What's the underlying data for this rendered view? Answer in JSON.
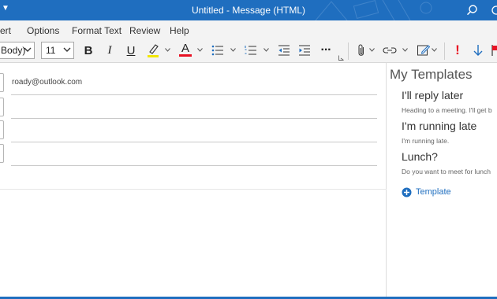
{
  "window": {
    "title": "Untitled  -  Message (HTML)",
    "accent": "#1f6ebf"
  },
  "menu": {
    "tabs": [
      "ert",
      "Options",
      "Format Text",
      "Review",
      "Help"
    ]
  },
  "ribbon": {
    "font_name": "Body)",
    "font_size": "11",
    "buttons": [
      "bold",
      "italic",
      "underline",
      "highlight",
      "font-color",
      "bullets",
      "numbering",
      "decrease-indent",
      "increase-indent",
      "more",
      "attach-file",
      "link",
      "signature",
      "high-importance",
      "low-importance"
    ],
    "bold_label": "B",
    "italic_label": "I",
    "underline_label": "U",
    "font_color_label": "A",
    "more_label": "···",
    "importance_label": "!",
    "highlight_color": "#f2e600",
    "font_color": "#e81123",
    "importance_color": "#e81123"
  },
  "compose": {
    "to_value": "roady@outlook.com",
    "cc_value": "",
    "bcc_value": "",
    "subject_value": ""
  },
  "templates_pane": {
    "title": "My Templates",
    "items": [
      {
        "title": "I'll reply later",
        "text": "Heading to a meeting. I'll get b"
      },
      {
        "title": "I'm running late",
        "text": "I'm running late."
      },
      {
        "title": "Lunch?",
        "text": "Do you want to meet for lunch"
      }
    ],
    "add_label": "Template"
  }
}
